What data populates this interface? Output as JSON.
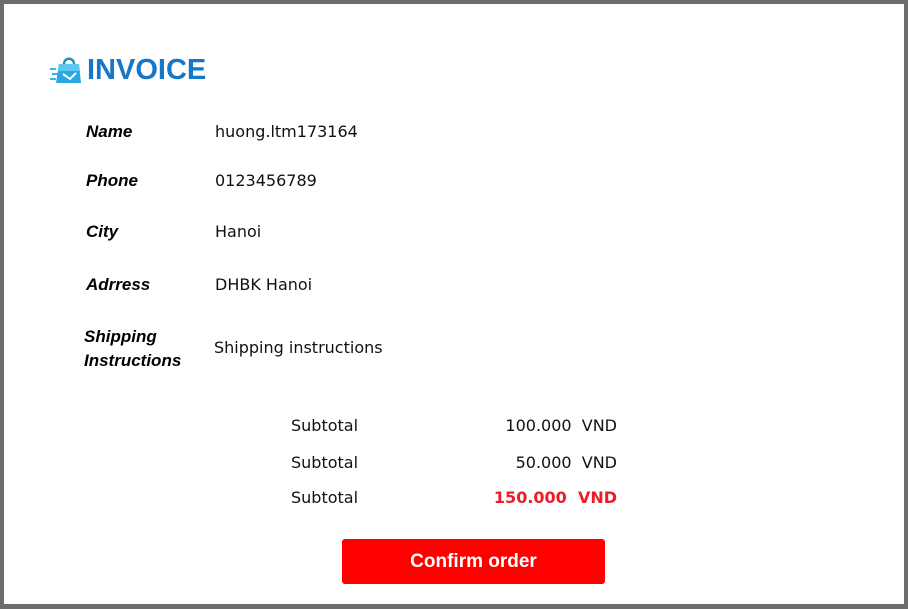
{
  "header": {
    "title": "INVOICE",
    "logo_icon": "shopping-bag-icon",
    "title_color": "#1677c9"
  },
  "form": {
    "name_label": "Name",
    "name_value": "huong.ltm173164",
    "phone_label": "Phone",
    "phone_value": "0123456789",
    "city_label": "City",
    "city_value": "Hanoi",
    "address_label": "Adrress",
    "address_value": "DHBK Hanoi",
    "shipping_label_line1": "Shipping",
    "shipping_label_line2": "Instructions",
    "shipping_value": "Shipping instructions"
  },
  "summary": {
    "rows": [
      {
        "label": "Subtotal",
        "amount": "100.000",
        "currency": "VND"
      },
      {
        "label": "Subtotal",
        "amount": "50.000",
        "currency": "VND"
      },
      {
        "label": "Subtotal",
        "amount": "150.000",
        "currency": "VND"
      }
    ],
    "total_color": "#ee1c24"
  },
  "actions": {
    "confirm_label": "Confirm order",
    "confirm_color": "#ff0000"
  }
}
